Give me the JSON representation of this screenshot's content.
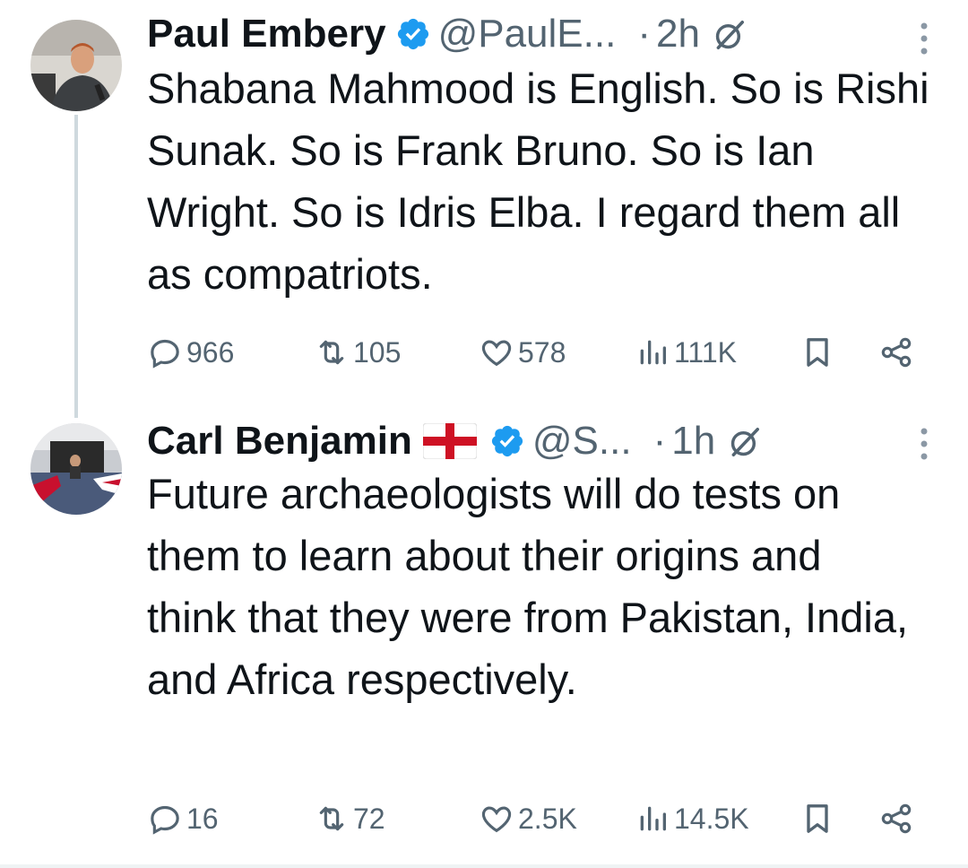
{
  "tweets": [
    {
      "name": "Paul Embery",
      "handle": "@PaulE...",
      "dot": "·",
      "time": "2h",
      "text": "Shabana Mahmood is English. So is Rishi Sunak. So is Frank Bruno. So is Ian Wright. So is Idris Elba. I regard them all as compatriots.",
      "replies": "966",
      "reposts": "105",
      "likes": "578",
      "views": "111K",
      "verified": true,
      "flag": null
    },
    {
      "name": "Carl Benjamin",
      "handle": "@S...",
      "dot": "·",
      "time": "1h",
      "text": "Future archaeologists will do tests on them to learn about their origins and think that they were from Pakistan, India, and Africa respectively.",
      "replies": "16",
      "reposts": "72",
      "likes": "2.5K",
      "views": "14.5K",
      "verified": true,
      "flag": "england-flag-icon"
    }
  ],
  "colors": {
    "text": "#0f1419",
    "secondary": "#536471",
    "verified": "#1d9bf0",
    "thread_line": "#cfd9de"
  }
}
